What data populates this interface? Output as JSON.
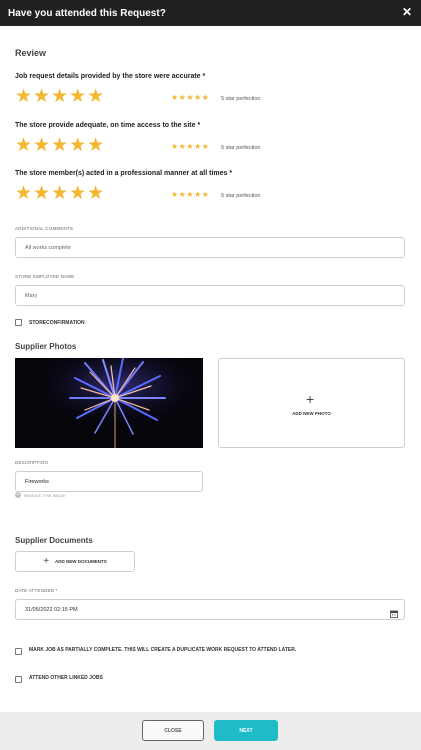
{
  "header": {
    "title": "Have you attended this Request?",
    "close_icon": "close-icon"
  },
  "review": {
    "title": "Review",
    "questions": [
      {
        "label": "Job request details provided by the store were accurate *",
        "rating": 5,
        "rating_text": "5 star perfection"
      },
      {
        "label": "The store provide adequate, on time access to the site *",
        "rating": 5,
        "rating_text": "5 star perfection"
      },
      {
        "label": "The store member(s) acted in a professional manner at all times *",
        "rating": 5,
        "rating_text": "5 star perfection"
      }
    ]
  },
  "comments": {
    "label": "ADDITIONAL COMMENTS",
    "value": "All works complete"
  },
  "employee": {
    "label": "STORE EMPLOYEE NAME",
    "value": "Mary"
  },
  "store_confirmation": {
    "label": "STORECONFIRMATION",
    "checked": false
  },
  "photos": {
    "title": "Supplier Photos",
    "add_label": "ADD NEW PHOTO",
    "description_label": "DESCRIPTION",
    "description_value": "Fireworks",
    "remove_label": "REMOVE THIS IMAGE"
  },
  "documents": {
    "title": "Supplier Documents",
    "add_label": "ADD NEW DOCUMENTS"
  },
  "date": {
    "label": "DATE ATTENDED *",
    "value": "31/05/2022 02:15 PM"
  },
  "options": {
    "partial": "MARK JOB AS PARTIALLY COMPLETE. THIS WILL CREATE A DUPLICATE WORK REQUEST TO ATTEND LATER.",
    "linked": "ATTEND OTHER LINKED JOBS"
  },
  "footer": {
    "close_label": "CLOSE",
    "next_label": "NEXT"
  },
  "colors": {
    "header_bg": "#202020",
    "star": "#f5b630",
    "accent": "#1fbcc8"
  }
}
